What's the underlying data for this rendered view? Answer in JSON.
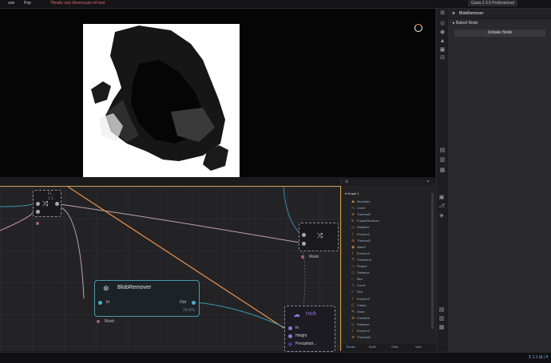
{
  "menu": {
    "items": [
      "oon",
      "Pop"
    ],
    "preset": "*Really sick Wormscale.lnf text",
    "badge": "Gaea 2.0.5 Professional"
  },
  "panel": {
    "title": "BlobRemover",
    "baked_label": "Baked Node",
    "unbake_label": "Unbake Node"
  },
  "graph": {
    "small_node_1": {
      "label": "Fi... 1.1..",
      "mask": ""
    },
    "small_node_2": {
      "label": "Mask"
    },
    "blob_node": {
      "title": "BlobRemover",
      "in_label": "In",
      "out_label": "Out",
      "value": "15.47s",
      "mask_label": "Mask"
    },
    "rock_node": {
      "title": "rock",
      "ports": [
        "In",
        "Height",
        "Precipitati..."
      ]
    }
  },
  "outliner": {
    "root": "Graph 1",
    "items": [
      {
        "label": "Mountain"
      },
      {
        "label": "Curve"
      },
      {
        "label": "Thermal2"
      },
      {
        "label": "FractalTerraces"
      },
      {
        "label": "Distance"
      },
      {
        "label": "Erosion2"
      },
      {
        "label": "Thermal2"
      },
      {
        "label": "Island"
      },
      {
        "label": "Erosion2"
      },
      {
        "label": "Transform"
      },
      {
        "label": "Shaper"
      },
      {
        "label": "Distance"
      },
      {
        "label": "Blur"
      },
      {
        "label": "Curve"
      },
      {
        "label": "Sea"
      },
      {
        "label": "Erosion2"
      },
      {
        "label": "Clamp"
      },
      {
        "label": "Draw"
      },
      {
        "label": "Combine"
      },
      {
        "label": "Distance"
      },
      {
        "label": "Erosion2"
      },
      {
        "label": "Thermal2"
      }
    ],
    "tabs": [
      "Terrain",
      "Build",
      "Stats",
      "Vars"
    ]
  },
  "status": {
    "text": "Σ 1.1 ⊞ | 4"
  },
  "icons": {
    "panel": "blob-remover-icon"
  },
  "colors": {
    "accent": "#c8a24a",
    "blob_border": "#4a9ab0",
    "rock_title": "#8a78d6"
  }
}
